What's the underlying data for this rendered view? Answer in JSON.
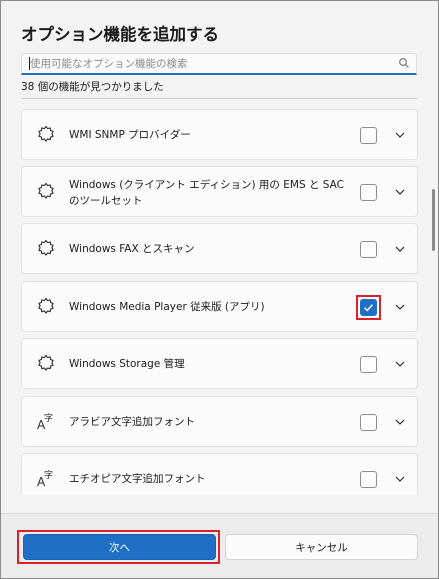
{
  "dialog": {
    "title": "オプション機能を追加する",
    "search_placeholder": "使用可能なオプション機能の検索",
    "search_value": "",
    "count_text": "38 個の機能が見つかりました"
  },
  "features": [
    {
      "label": "WMI SNMP プロバイダー",
      "icon": "gear-icon",
      "checked": false
    },
    {
      "label": "Windows (クライアント エディション) 用の EMS と SAC のツールセット",
      "icon": "gear-icon",
      "checked": false
    },
    {
      "label": "Windows FAX とスキャン",
      "icon": "gear-icon",
      "checked": false
    },
    {
      "label": "Windows Media Player 従来版 (アプリ)",
      "icon": "gear-icon",
      "checked": true
    },
    {
      "label": "Windows Storage 管理",
      "icon": "gear-icon",
      "checked": false
    },
    {
      "label": "アラビア文字追加フォント",
      "icon": "font-icon",
      "checked": false
    },
    {
      "label": "エチオピア文字追加フォント",
      "icon": "font-icon",
      "checked": false
    }
  ],
  "buttons": {
    "next_label": "次へ",
    "cancel_label": "キャンセル"
  },
  "colors": {
    "accent": "#1f6fc5",
    "highlight": "#d9222c"
  }
}
